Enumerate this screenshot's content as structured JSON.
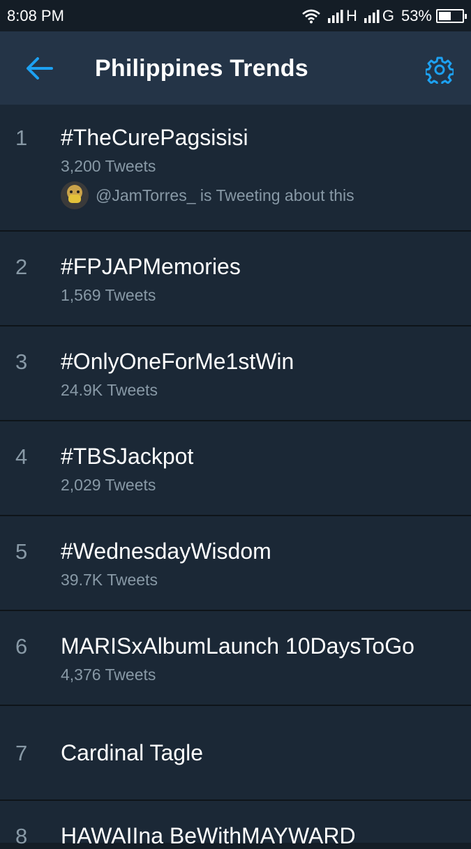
{
  "status_bar": {
    "time": "8:08 PM",
    "network_1": "H",
    "network_2": "G",
    "battery_percent": "53%",
    "battery_level": 0.53
  },
  "header": {
    "title": "Philippines Trends",
    "back_icon": "arrow-left-icon",
    "settings_icon": "gear-icon",
    "accent_color": "#1da1f2"
  },
  "trends": [
    {
      "rank": "1",
      "name": "#TheCurePagsisisi",
      "count": "3,200 Tweets",
      "context": "@JamTorres_ is Tweeting about this"
    },
    {
      "rank": "2",
      "name": "#FPJAPMemories",
      "count": "1,569 Tweets"
    },
    {
      "rank": "3",
      "name": "#OnlyOneForMe1stWin",
      "count": "24.9K Tweets"
    },
    {
      "rank": "4",
      "name": "#TBSJackpot",
      "count": "2,029 Tweets"
    },
    {
      "rank": "5",
      "name": "#WednesdayWisdom",
      "count": "39.7K Tweets"
    },
    {
      "rank": "6",
      "name": "MARISxAlbumLaunch 10DaysToGo",
      "count": "4,376 Tweets"
    },
    {
      "rank": "7",
      "name": "Cardinal Tagle"
    },
    {
      "rank": "8",
      "name": "HAWAIIna BeWithMAYWARD"
    }
  ]
}
